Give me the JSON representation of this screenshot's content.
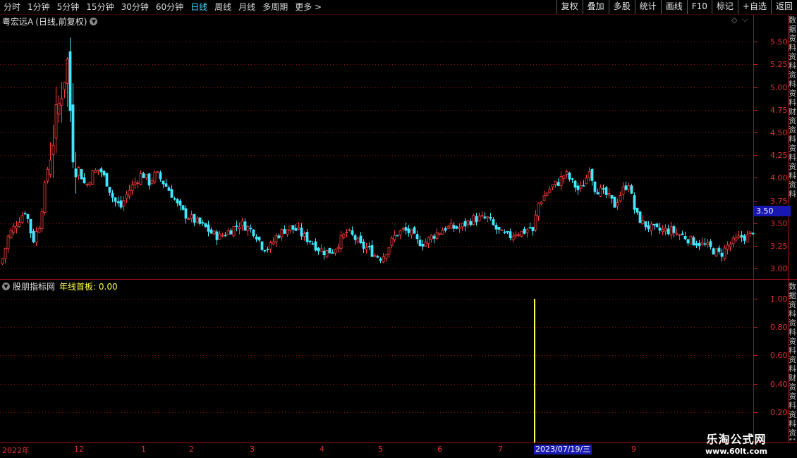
{
  "toolbar": {
    "periods": [
      "分时",
      "1分钟",
      "5分钟",
      "15分钟",
      "30分钟",
      "60分钟",
      "日线",
      "周线",
      "月线",
      "多周期",
      "更多 >"
    ],
    "active": "日线",
    "buttons": [
      "复权",
      "叠加",
      "多股",
      "统计",
      "画线",
      "F10",
      "标记",
      "+自选",
      "返回"
    ]
  },
  "main_panel": {
    "title": "粤宏远A",
    "subtitle": "(日线,前复权)",
    "current_price": "3.50"
  },
  "indicator_panel": {
    "name": "股朋指标网",
    "line_label": "年线首板: 0.00"
  },
  "x_axis": {
    "year_label": "2022年",
    "month_labels": [
      "12",
      "1",
      "2",
      "3",
      "4",
      "5",
      "6",
      "7",
      "9"
    ],
    "cursor_date": "2023/07/19/三"
  },
  "right_strip_chars": "数据资料资料资料资料财资资料资料资料资料",
  "watermark": {
    "title": "乐淘公式网",
    "url": "www.60lt.com"
  },
  "colors": {
    "up": "#ff3c3c",
    "down": "#40e8ff",
    "grid": "#8a1010",
    "signal": "#ffff40"
  },
  "chart_data": [
    {
      "type": "candlestick",
      "title": "粤宏远A (日线,前复权)",
      "y_ticks": [
        3.0,
        3.25,
        3.5,
        3.75,
        4.0,
        4.25,
        4.5,
        4.75,
        5.0,
        5.25,
        5.5
      ],
      "ylim": [
        2.9,
        5.65
      ],
      "x_labels": [
        "2022年",
        "12",
        "1",
        "2",
        "3",
        "4",
        "5",
        "6",
        "7",
        "9"
      ],
      "close_anchors": [
        [
          0,
          3.05
        ],
        [
          10,
          3.35
        ],
        [
          22,
          3.5
        ],
        [
          35,
          3.65
        ],
        [
          45,
          3.3
        ],
        [
          55,
          3.5
        ],
        [
          62,
          3.9
        ],
        [
          70,
          4.3
        ],
        [
          80,
          4.7
        ],
        [
          88,
          5.1
        ],
        [
          95,
          5.3
        ],
        [
          100,
          4.4
        ],
        [
          110,
          4.1
        ],
        [
          120,
          3.9
        ],
        [
          130,
          4.05
        ],
        [
          140,
          4.1
        ],
        [
          150,
          3.95
        ],
        [
          160,
          3.75
        ],
        [
          170,
          3.68
        ],
        [
          180,
          3.85
        ],
        [
          190,
          3.95
        ],
        [
          200,
          4.05
        ],
        [
          210,
          3.95
        ],
        [
          220,
          4.05
        ],
        [
          230,
          3.95
        ],
        [
          240,
          3.85
        ],
        [
          250,
          3.7
        ],
        [
          260,
          3.6
        ],
        [
          270,
          3.55
        ],
        [
          280,
          3.5
        ],
        [
          290,
          3.45
        ],
        [
          300,
          3.38
        ],
        [
          310,
          3.35
        ],
        [
          320,
          3.4
        ],
        [
          330,
          3.45
        ],
        [
          340,
          3.5
        ],
        [
          350,
          3.45
        ],
        [
          360,
          3.4
        ],
        [
          370,
          3.25
        ],
        [
          380,
          3.22
        ],
        [
          390,
          3.35
        ],
        [
          400,
          3.42
        ],
        [
          410,
          3.45
        ],
        [
          420,
          3.42
        ],
        [
          430,
          3.35
        ],
        [
          440,
          3.3
        ],
        [
          450,
          3.22
        ],
        [
          460,
          3.18
        ],
        [
          470,
          3.2
        ],
        [
          480,
          3.3
        ],
        [
          490,
          3.4
        ],
        [
          500,
          3.35
        ],
        [
          510,
          3.25
        ],
        [
          520,
          3.22
        ],
        [
          530,
          3.15
        ],
        [
          540,
          3.12
        ],
        [
          550,
          3.25
        ],
        [
          560,
          3.38
        ],
        [
          570,
          3.42
        ],
        [
          580,
          3.4
        ],
        [
          590,
          3.3
        ],
        [
          600,
          3.28
        ],
        [
          610,
          3.35
        ],
        [
          620,
          3.4
        ],
        [
          630,
          3.45
        ],
        [
          640,
          3.45
        ],
        [
          650,
          3.45
        ],
        [
          660,
          3.5
        ],
        [
          670,
          3.55
        ],
        [
          680,
          3.55
        ],
        [
          690,
          3.55
        ],
        [
          700,
          3.45
        ],
        [
          710,
          3.38
        ],
        [
          720,
          3.35
        ],
        [
          730,
          3.4
        ],
        [
          740,
          3.4
        ],
        [
          750,
          3.45
        ],
        [
          755,
          3.38
        ],
        [
          760,
          3.7
        ],
        [
          770,
          3.8
        ],
        [
          780,
          3.9
        ],
        [
          790,
          3.95
        ],
        [
          800,
          4.05
        ],
        [
          810,
          3.95
        ],
        [
          820,
          3.85
        ],
        [
          830,
          4.0
        ],
        [
          835,
          4.15
        ],
        [
          840,
          3.9
        ],
        [
          850,
          3.85
        ],
        [
          860,
          3.8
        ],
        [
          870,
          3.7
        ],
        [
          880,
          3.85
        ],
        [
          890,
          3.95
        ],
        [
          895,
          3.75
        ],
        [
          900,
          3.6
        ],
        [
          910,
          3.5
        ],
        [
          920,
          3.45
        ],
        [
          930,
          3.42
        ],
        [
          940,
          3.42
        ],
        [
          950,
          3.42
        ],
        [
          960,
          3.38
        ],
        [
          970,
          3.35
        ],
        [
          980,
          3.3
        ],
        [
          990,
          3.28
        ],
        [
          1000,
          3.25
        ],
        [
          1010,
          3.2
        ],
        [
          1020,
          3.15
        ],
        [
          1030,
          3.25
        ],
        [
          1040,
          3.3
        ],
        [
          1050,
          3.35
        ],
        [
          1060,
          3.35
        ],
        [
          1068,
          3.45
        ]
      ]
    },
    {
      "type": "bar",
      "title": "股朋指标网 年线首板: 0.00",
      "y_ticks": [
        0.2,
        0.4,
        0.6,
        0.8,
        1.0
      ],
      "ylim": [
        0,
        1.1
      ],
      "series": [
        {
          "name": "年线首板",
          "signal_date": "2023/07/19/三",
          "value": 1.0,
          "current": 0.0
        }
      ]
    }
  ]
}
